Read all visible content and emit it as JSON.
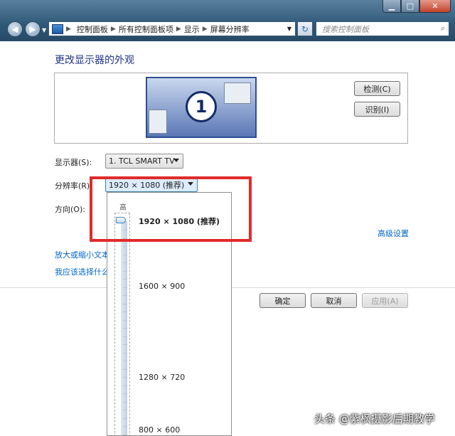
{
  "window": {
    "minimize": "▁",
    "maximize": "□",
    "close": "✕"
  },
  "address": {
    "crumbs": [
      "控制面板",
      "所有控制面板项",
      "显示",
      "屏幕分辨率"
    ]
  },
  "search": {
    "placeholder": "搜索控制面板"
  },
  "page": {
    "title": "更改显示器的外观",
    "monitor_number": "1",
    "detect_button": "检测(C)",
    "identify_button": "识别(I)",
    "display_label": "显示器(S):",
    "display_value": "1. TCL SMART TV",
    "resolution_label": "分辨率(R):",
    "resolution_value": "1920 × 1080 (推荐)",
    "orientation_label": "方向(O):",
    "advanced_link": "高级设置",
    "link_text_size": "放大或缩小文本",
    "link_choose": "我应该选择什么",
    "ok_button": "确定",
    "cancel_button": "取消",
    "apply_button": "应用(A)"
  },
  "resolution_dropdown": {
    "high_label": "高",
    "options": [
      "1920 × 1080 (推荐)",
      "1600 × 900",
      "1280 × 720",
      "800 × 600"
    ],
    "selected_index": 0
  },
  "watermark": "头条 @紫枫摄影后期教学",
  "colors": {
    "title_blue": "#1e3287",
    "link_blue": "#0066cc",
    "highlight_red": "#e02b2b"
  }
}
